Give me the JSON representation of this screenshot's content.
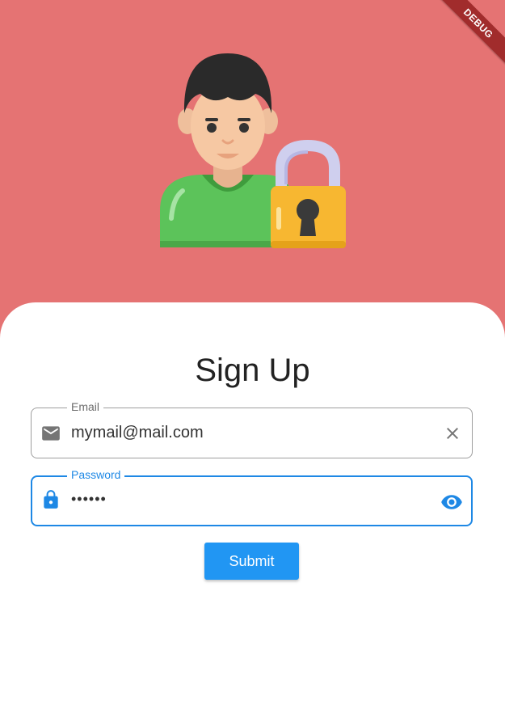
{
  "debug_banner": "DEBUG",
  "form": {
    "title": "Sign Up",
    "email": {
      "label": "Email",
      "value": "mymail@mail.com",
      "lead_icon": "email-icon",
      "trail_icon": "clear-icon"
    },
    "password": {
      "label": "Password",
      "value": "••••••",
      "lead_icon": "lock-icon",
      "trail_icon": "visibility-icon"
    },
    "submit_label": "Submit"
  },
  "colors": {
    "header_bg": "#e57373",
    "accent": "#2196f3",
    "focus_border": "#1e88e5",
    "card_bg": "#ffffff"
  }
}
